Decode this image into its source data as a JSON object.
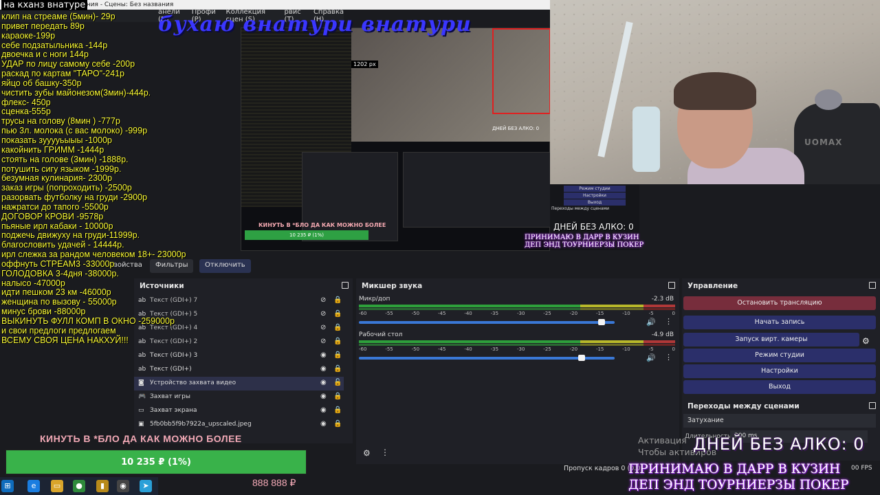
{
  "window": {
    "title_fragment": "вания - Сцены: Без названия",
    "menu_fragment": [
      "анели (D)",
      "Профи (P)",
      "Коллекция сцен (S)",
      "рвис (T)",
      "Справка (H)"
    ]
  },
  "topleft_label": "на кханз внатуре",
  "banner": "бухаю внатури внатури",
  "price_list": [
    "клип на стреаме (5мин)- 29р",
    "привет передать 89р",
    "караоке-199р",
    "себе подзатыльника -144р",
    "двоечка и с ноги 144р",
    "УДАР по лицу самому себе -200р",
    "раскад по картам \"ТАРО\"-241р",
    "яйцо об башку-350р",
    "чистить зубы майонезом(3мин)-444р.",
    "флекс- 450р",
    "сценка-555р",
    "трусы на голову (8мин ) -777р",
    "пью 3л. молока (с вас молоко) -999р",
    "показать зууууьыыы -1000р",
    "какойнить ГРИММ -1444р",
    "стоять на голове (3мин) -1888р.",
    "потушить сигу языком -1999р.",
    "безумная кулинария- 2300р",
    "заказ игры (попроходить) -2500р",
    "разорвать футболку на груди -2900р",
    "нажратси до тапого -5500р",
    "ДОГОВОР КРОВИ -9578р",
    "пьяные ирл кабаки - 10000р",
    "поджечь движуху на груди-11999р.",
    "благословить удачей - 14444р.",
    "ирл слежка за рандом человеком 18+- 23000р",
    "оффнуть СТРЕАМ3 -33000р",
    "ГОЛОДОВКА 3-4дня -38000р.",
    "налысо -47000р",
    "идти пешком 23 км -46000р",
    "женщина по вызову - 55000р",
    "минус брови -88000р",
    "ВЫКИНУТЬ ФУЛЛ КОМП В ОКНО -259000р",
    "и свои предлоги предлогаем",
    "ВСЕМУ СВОЯ ЦЕНА НАКХУЙ!!!"
  ],
  "preview": {
    "px_badge": "1202 px",
    "mini_kinut": "КИНУТЬ В *БЛО ДА КАК МОЖНО БОЛЕЕ",
    "mini_donate": "10 235 ₽ (1%)",
    "mini_days": "ДНЕЙ БЕЗ АЛКО: 0"
  },
  "webcam": {
    "chair_logo": "UOMAX"
  },
  "cam_overlay": {
    "buttons": [
      "Режим студии",
      "Настройки",
      "Выход"
    ],
    "transitions_label": "Переходы между сценами",
    "days": "ДНЕЙ БЕЗ АЛКО: 0",
    "promo": [
      "ПРИНИМАЮ В ДАРР В КУЗИН",
      "ДЕП ЭНД ТОУРНИЕРЗЫ ПОКЕР"
    ]
  },
  "toolbar": {
    "properties": "Свойства",
    "filters": "Фильтры",
    "disconnect": "Отключить"
  },
  "sources": {
    "title": "Источники",
    "items": [
      {
        "name": "Текст (GDI+) 7",
        "icon": "text-icon",
        "visible": false,
        "locked": true
      },
      {
        "name": "Текст (GDI+) 5",
        "icon": "text-icon",
        "visible": false,
        "locked": true
      },
      {
        "name": "Текст (GDI+) 4",
        "icon": "text-icon",
        "visible": false,
        "locked": true
      },
      {
        "name": "Текст (GDI+) 2",
        "icon": "text-icon",
        "visible": false,
        "locked": true
      },
      {
        "name": "Текст (GDI+) 3",
        "icon": "text-icon",
        "visible": true,
        "locked": true
      },
      {
        "name": "Текст (GDI+)",
        "icon": "text-icon",
        "visible": true,
        "locked": true
      },
      {
        "name": "Устройство захвата видео",
        "icon": "camera-icon",
        "visible": true,
        "locked": false
      },
      {
        "name": "Захват игры",
        "icon": "gamepad-icon",
        "visible": true,
        "locked": true
      },
      {
        "name": "Захват экрана",
        "icon": "monitor-icon",
        "visible": true,
        "locked": true
      },
      {
        "name": "5fb0bb5f9b7922a_upscaled.jpeg",
        "icon": "image-icon",
        "visible": true,
        "locked": true
      }
    ]
  },
  "mixer": {
    "title": "Микшер звука",
    "ticks": [
      "-60",
      "-55",
      "-50",
      "-45",
      "-40",
      "-35",
      "-30",
      "-25",
      "-20",
      "-15",
      "-10",
      "-5",
      "0"
    ],
    "channels": [
      {
        "name": "Микр/доп",
        "db": "-2.3 dB",
        "volume": 0.95
      },
      {
        "name": "Рабочий стол",
        "db": "-4.9 dB",
        "volume": 0.87
      }
    ]
  },
  "controls": {
    "title": "Управление",
    "stop_stream": "Остановить трансляцию",
    "start_record": "Начать запись",
    "virtual_cam": "Запуск вирт. камеры",
    "studio_mode": "Режим студии",
    "settings": "Настройки",
    "exit": "Выход"
  },
  "transitions": {
    "title": "Переходы между сценами",
    "selected": "Затухание",
    "duration_label": "Длительность",
    "duration_value": "300 ms"
  },
  "activation": [
    "Активация",
    "Чтобы активиров"
  ],
  "overlay": {
    "days": "ДНЕЙ БЕЗ АЛКО: 0",
    "promo_line1": "ПРИНИМАЮ В ДАРР В КУЗИН",
    "promo_line2": "ДЕП ЭНД ТОУРНИЕРЗЫ ПОКЕР"
  },
  "donation": {
    "kinut": "КИНУТЬ В *БЛО ДА КАК МОЖНО БОЛЕЕ",
    "goal_text": "10 235 ₽ (1%)",
    "progress": 0.01,
    "amount": "888 888 ₽"
  },
  "statusbar": {
    "dropped": "Пропуск кадров 0 (0.0",
    "fps": "00 FPS"
  },
  "colors": {
    "accent_blue": "#2b2f6a",
    "stop_red": "#772d3c",
    "goal_green": "#39b24a",
    "price_yellow": "#ffff38"
  }
}
